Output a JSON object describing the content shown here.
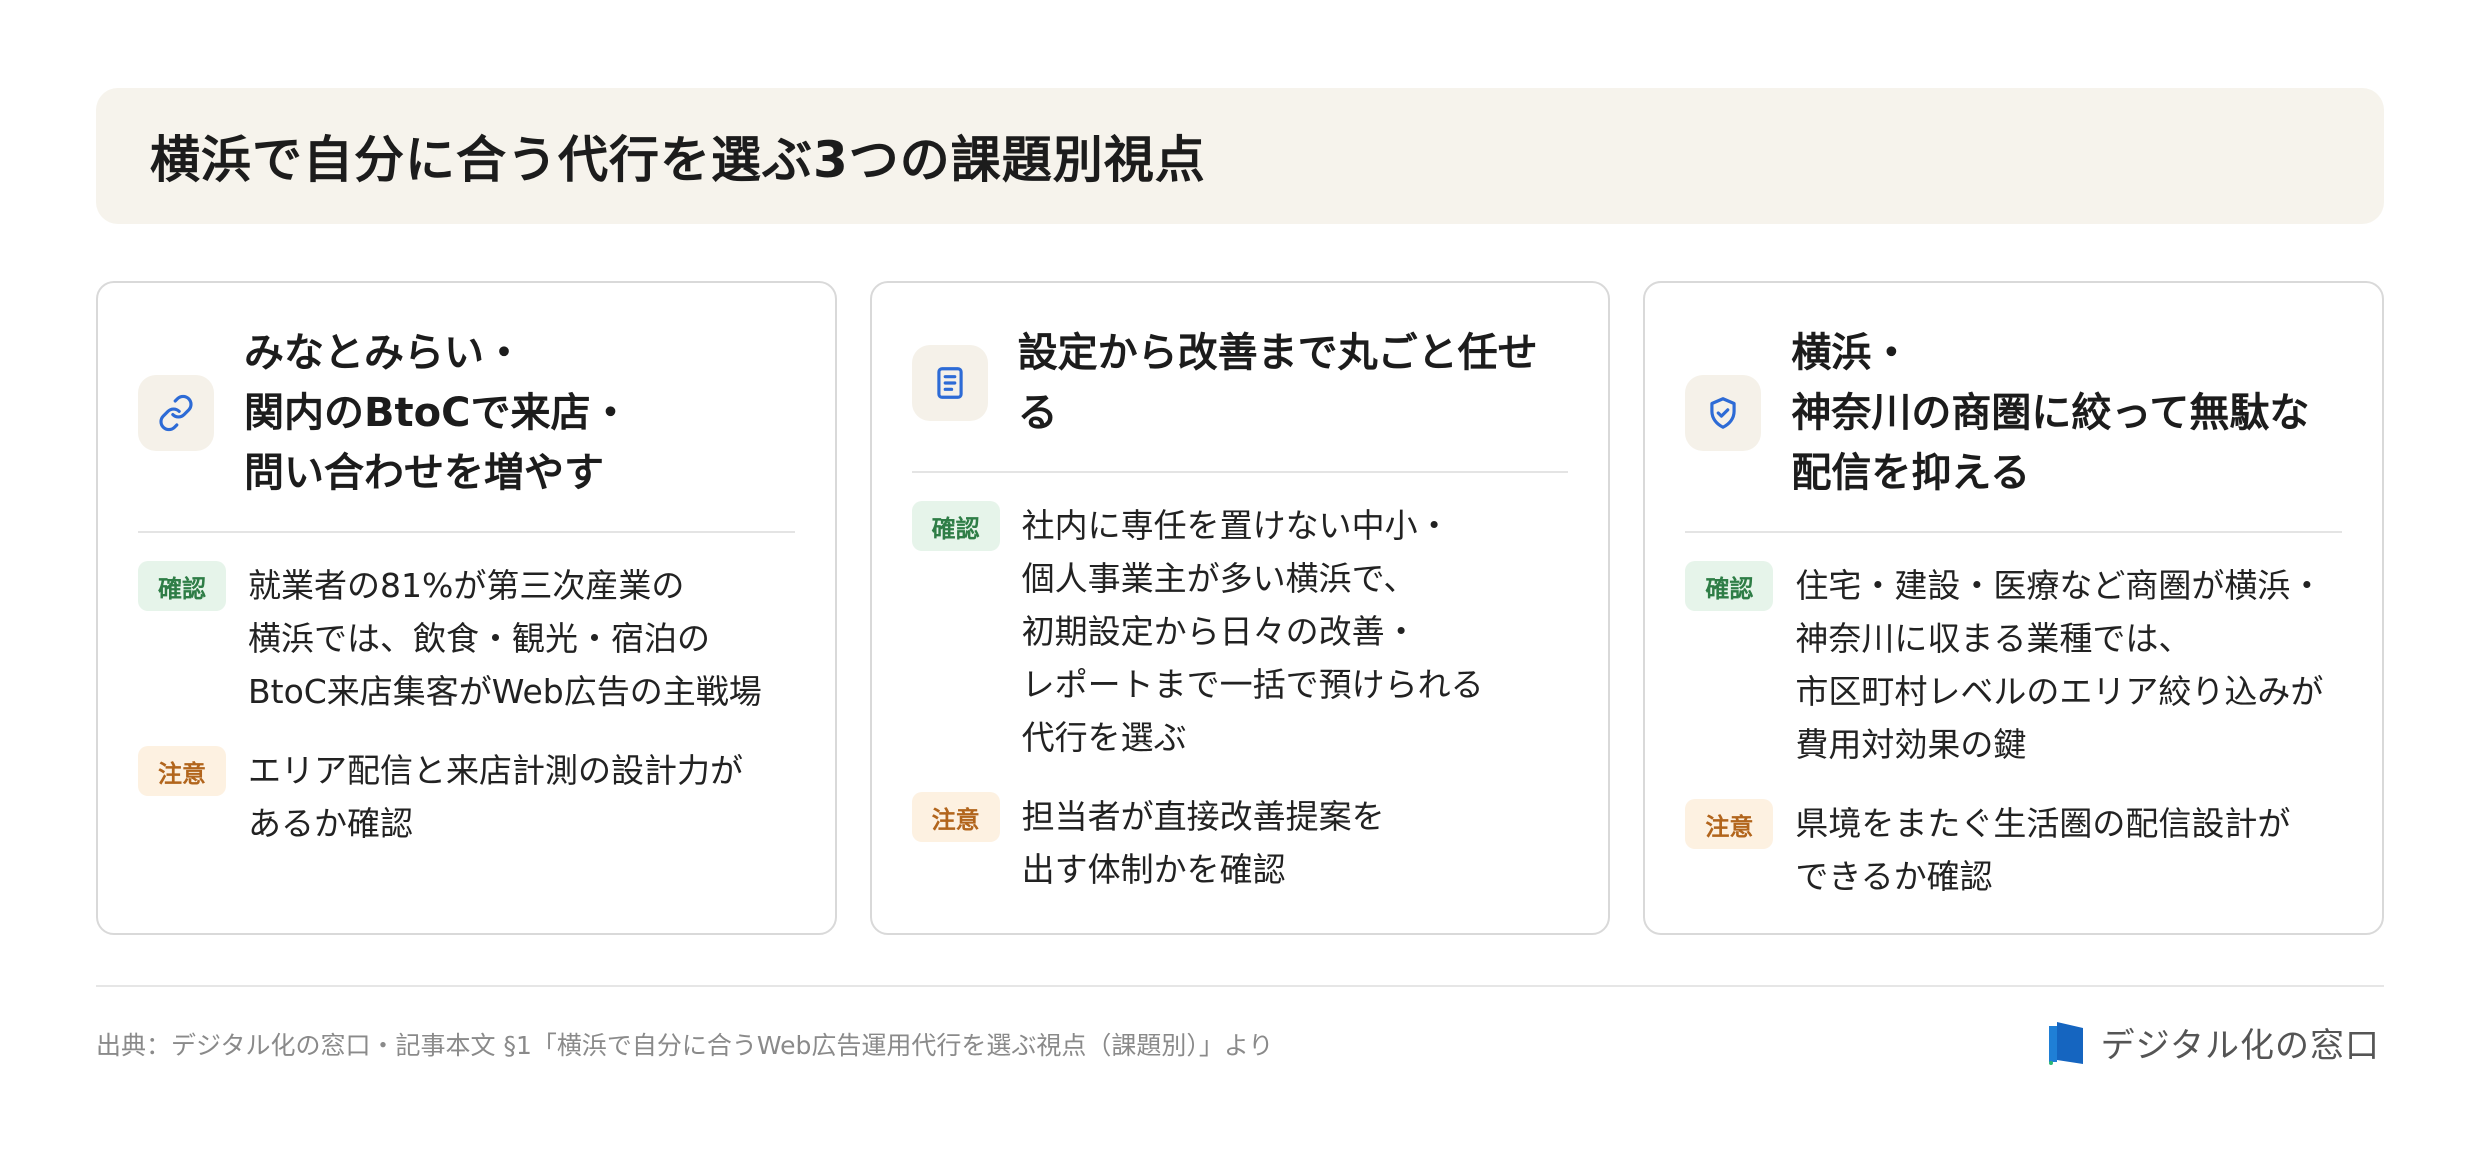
{
  "header": {
    "title": "横浜で自分に合う代行を選ぶ3つの課題別視点"
  },
  "colors": {
    "accent_blue": "#2d6bd6",
    "confirm_green": "#2e7d46",
    "caution_orange": "#b2651c"
  },
  "cards": [
    {
      "icon": "link-icon",
      "title": "みなとみらい・\n関内のBtoCで来店・\n問い合わせを増やす",
      "confirm_label": "確認",
      "confirm_text": "就業者の81%が第三次産業の\n横浜では、飲食・観光・宿泊の\nBtoC来店集客がWeb広告の主戦場",
      "caution_label": "注意",
      "caution_text": "エリア配信と来店計測の設計力が\nあるか確認"
    },
    {
      "icon": "document-icon",
      "title": "設定から改善まで丸ごと任せ\nる",
      "confirm_label": "確認",
      "confirm_text": "社内に専任を置けない中小・\n個人事業主が多い横浜で、\n初期設定から日々の改善・\nレポートまで一括で預けられる\n代行を選ぶ",
      "caution_label": "注意",
      "caution_text": "担当者が直接改善提案を\n出す体制かを確認"
    },
    {
      "icon": "shield-check-icon",
      "title": "横浜・\n神奈川の商圏に絞って無駄な\n配信を抑える",
      "confirm_label": "確認",
      "confirm_text": "住宅・建設・医療など商圏が横浜・\n神奈川に収まる業種では、\n市区町村レベルのエリア絞り込みが\n費用対効果の鍵",
      "caution_label": "注意",
      "caution_text": "県境をまたぐ生活圏の配信設計が\nできるか確認"
    }
  ],
  "footer": {
    "source": "出典：デジタル化の窓口・記事本文 §1「横浜で自分に合うWeb広告運用代行を選ぶ視点（課題別）」より",
    "brand": "デジタル化の窓口",
    "brand_icon": "brand-logo-icon"
  }
}
